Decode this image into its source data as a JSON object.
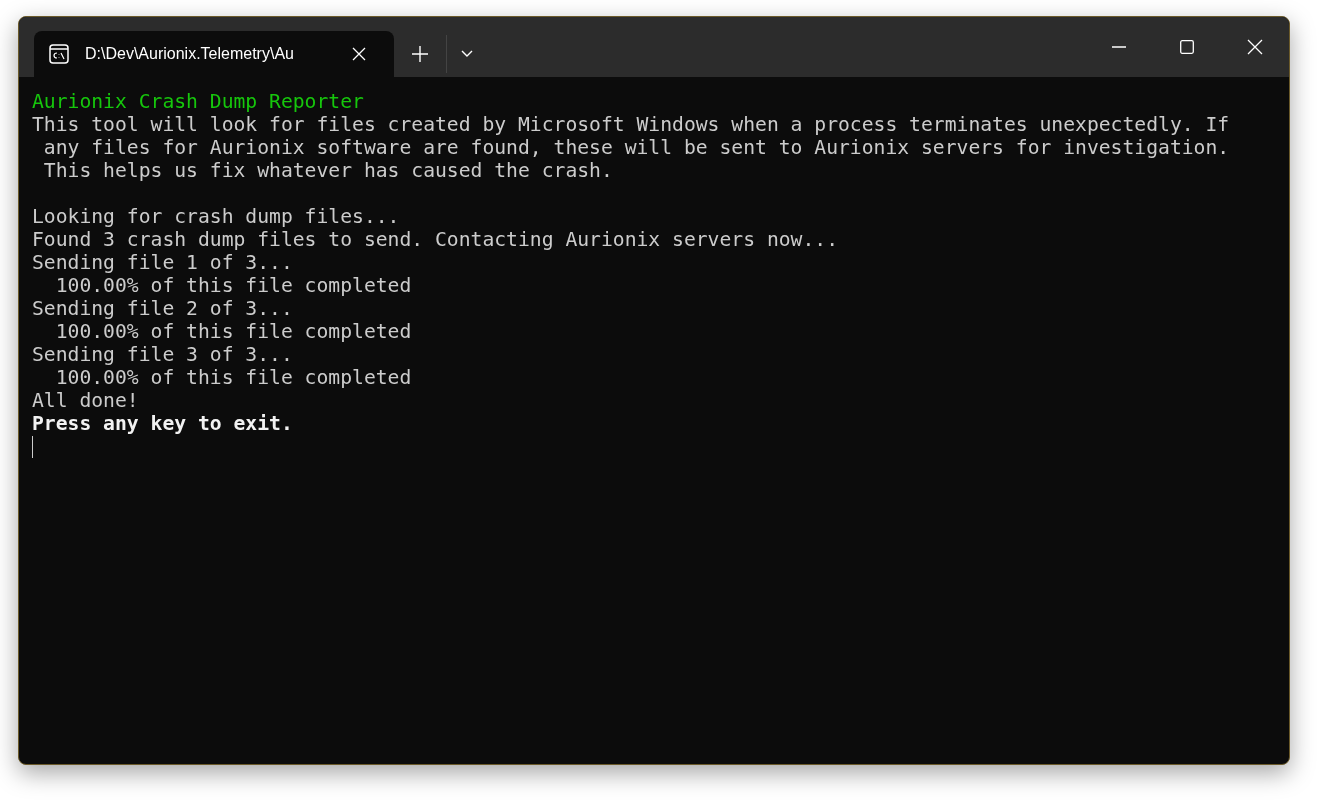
{
  "tab": {
    "title": "D:\\Dev\\Aurionix.Telemetry\\Au",
    "selected": true
  },
  "lines": [
    {
      "kind": "heading",
      "text": "Aurionix Crash Dump Reporter"
    },
    {
      "kind": "normal",
      "text": "This tool will look for files created by Microsoft Windows when a process terminates unexpectedly. If"
    },
    {
      "kind": "normal",
      "text": " any files for Aurionix software are found, these will be sent to Aurionix servers for investigation."
    },
    {
      "kind": "normal",
      "text": " This helps us fix whatever has caused the crash."
    },
    {
      "kind": "blank"
    },
    {
      "kind": "normal",
      "text": "Looking for crash dump files..."
    },
    {
      "kind": "normal",
      "text": "Found 3 crash dump files to send. Contacting Aurionix servers now..."
    },
    {
      "kind": "normal",
      "text": "Sending file 1 of 3..."
    },
    {
      "kind": "normal",
      "text": "  100.00% of this file completed"
    },
    {
      "kind": "normal",
      "text": "Sending file 2 of 3..."
    },
    {
      "kind": "normal",
      "text": "  100.00% of this file completed"
    },
    {
      "kind": "normal",
      "text": "Sending file 3 of 3..."
    },
    {
      "kind": "normal",
      "text": "  100.00% of this file completed"
    },
    {
      "kind": "normal",
      "text": "All done!"
    },
    {
      "kind": "emphasis",
      "text": "Press any key to exit."
    }
  ]
}
